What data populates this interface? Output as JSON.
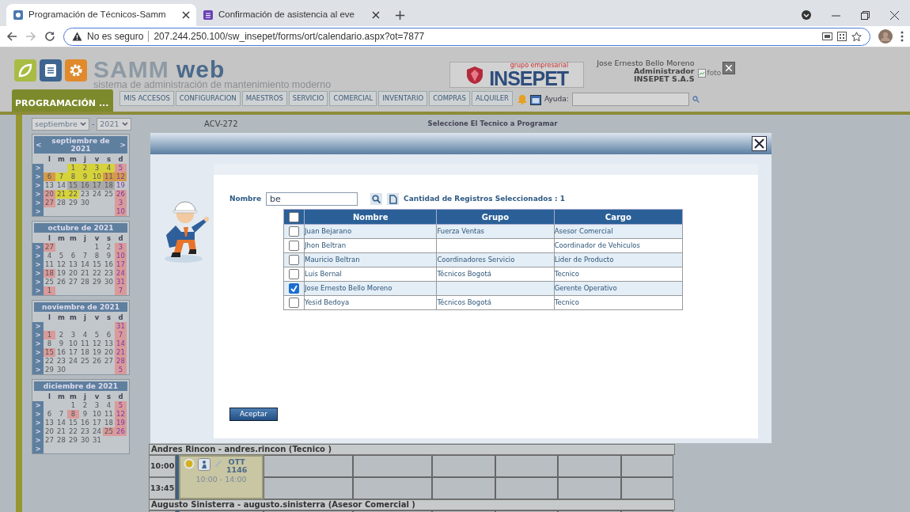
{
  "browser": {
    "tabs": [
      {
        "title": "Programación de Técnicos-Samm",
        "selected": true
      },
      {
        "title": "Confirmación de asistencia al eve",
        "selected": false
      }
    ],
    "new_tab": "+",
    "security": "No es seguro",
    "url": "207.244.250.100/sw_insepet/forms/ort/calendario.aspx?ot=7877"
  },
  "header": {
    "app_name": "SAMM",
    "app_name_suffix": "web",
    "subtitle": "sistema de administración de mantenimiento moderno",
    "partner_tag": "grupo empresarial",
    "partner_name": "INSEPET",
    "user": {
      "name": "Jose Ernesto Bello Moreno",
      "role": "Administrador",
      "company": "INSEPET S.A.S",
      "photo_alt": "foto"
    }
  },
  "nav": {
    "section": "PROGRAMACIÓN ...",
    "items": [
      "MIS ACCESOS",
      "CONFIGURACION",
      "MAESTROS",
      "SERVICIO",
      "COMERCIAL",
      "INVENTARIO",
      "COMPRAS",
      "ALQUILER"
    ],
    "help_label": "Ayuda:"
  },
  "month_picker": {
    "month": "septiembre",
    "separator": "-",
    "year": "2021"
  },
  "calendars": [
    {
      "title": "septiembre de 2021",
      "prev": "<",
      "next": ">",
      "weekdays": [
        "l",
        "m",
        "m",
        "j",
        "v",
        "s",
        "d"
      ],
      "weeks": [
        {
          "marker": ">",
          "mi": {
            "text": "1",
            "color": "#d6d23a"
          },
          "j": {
            "text": "2",
            "color": "#d6d23a"
          },
          "v": {
            "text": "3",
            "color": "#d6d23a"
          },
          "s": {
            "text": "4",
            "color": "#d6d23a"
          },
          "d": {
            "text": "5",
            "color": "#d99a9a"
          }
        },
        {
          "marker": ">",
          "l": {
            "text": "6",
            "color": "#d49a4c"
          },
          "ma": {
            "text": "7",
            "color": "#d6d23a"
          },
          "mi": {
            "text": "8",
            "color": "#d6d23a"
          },
          "j": {
            "text": "9",
            "color": "#d6d23a"
          },
          "v": {
            "text": "10",
            "color": "#d6d23a"
          },
          "s": {
            "text": "11",
            "color": "#d49a4c"
          },
          "d": {
            "text": "12",
            "color": "#d49a4c"
          }
        },
        {
          "marker": ">",
          "l": "13",
          "ma": "14",
          "mi": {
            "text": "15",
            "color": "#a9a9a9"
          },
          "j": {
            "text": "16",
            "color": "#a9a9a9"
          },
          "v": {
            "text": "17",
            "color": "#a9a9a9"
          },
          "s": {
            "text": "18",
            "color": "#a9a9a9"
          },
          "d": "19"
        },
        {
          "marker": ">",
          "l": {
            "text": "20",
            "color": "#d99a9a"
          },
          "ma": {
            "text": "21",
            "color": "#d6d23a"
          },
          "mi": {
            "text": "22",
            "color": "#d6d23a"
          },
          "j": "23",
          "v": "24",
          "s": "25",
          "d": {
            "text": "26",
            "color": "#d99a9a"
          }
        },
        {
          "marker": ">",
          "l": {
            "text": "27",
            "color": "#d99a9a"
          },
          "ma": "28",
          "mi": "29",
          "j": "30",
          "d": {
            "text": "3",
            "color": "#d99a9a"
          }
        },
        {
          "marker": ">",
          "d": {
            "text": "10",
            "color": "#d99a9a"
          }
        }
      ]
    },
    {
      "title": "octubre de 2021",
      "weekdays": [
        "l",
        "m",
        "m",
        "j",
        "v",
        "s",
        "d"
      ],
      "weeks": [
        {
          "marker": ">",
          "l": {
            "text": "27",
            "color": "#d99a9a"
          },
          "v": "1",
          "s": "2",
          "d": {
            "text": "3",
            "color": "#d99a9a"
          }
        },
        {
          "marker": ">",
          "l": "4",
          "ma": "5",
          "mi": "6",
          "j": "7",
          "v": "8",
          "s": "9",
          "d": {
            "text": "10",
            "color": "#d99a9a"
          }
        },
        {
          "marker": ">",
          "l": "11",
          "ma": "12",
          "mi": "13",
          "j": "14",
          "v": "15",
          "s": "16",
          "d": {
            "text": "17",
            "color": "#d99a9a"
          }
        },
        {
          "marker": ">",
          "l": {
            "text": "18",
            "color": "#d99a9a"
          },
          "ma": "19",
          "mi": "20",
          "j": "21",
          "v": "22",
          "s": "23",
          "d": {
            "text": "24",
            "color": "#d99a9a"
          }
        },
        {
          "marker": ">",
          "l": "25",
          "ma": "26",
          "mi": "27",
          "j": "28",
          "v": "29",
          "s": "30",
          "d": {
            "text": "31",
            "color": "#d99a9a"
          }
        },
        {
          "marker": ">",
          "l": {
            "text": "1",
            "color": "#d99a9a"
          },
          "d": {
            "text": "7",
            "color": "#d99a9a"
          }
        }
      ]
    },
    {
      "title": "noviembre de 2021",
      "weekdays": [
        "l",
        "m",
        "m",
        "j",
        "v",
        "s",
        "d"
      ],
      "weeks": [
        {
          "marker": ">",
          "d": {
            "text": "31",
            "color": "#d99a9a"
          }
        },
        {
          "marker": ">",
          "l": {
            "text": "1",
            "color": "#d99a9a"
          },
          "ma": "2",
          "mi": "3",
          "j": "4",
          "v": "5",
          "s": "6",
          "d": {
            "text": "7",
            "color": "#d99a9a"
          }
        },
        {
          "marker": ">",
          "l": "8",
          "ma": "9",
          "mi": "10",
          "j": "11",
          "v": "12",
          "s": "13",
          "d": {
            "text": "14",
            "color": "#d99a9a"
          }
        },
        {
          "marker": ">",
          "l": {
            "text": "15",
            "color": "#d99a9a"
          },
          "ma": "16",
          "mi": "17",
          "j": "18",
          "v": "19",
          "s": "20",
          "d": {
            "text": "21",
            "color": "#d99a9a"
          }
        },
        {
          "marker": ">",
          "l": "22",
          "ma": "23",
          "mi": "24",
          "j": "25",
          "v": "26",
          "s": "27",
          "d": {
            "text": "28",
            "color": "#d99a9a"
          }
        },
        {
          "marker": ">",
          "l": "29",
          "ma": "30",
          "d": {
            "text": "5",
            "color": "#d99a9a"
          }
        }
      ]
    },
    {
      "title": "diciembre de 2021",
      "weekdays": [
        "l",
        "m",
        "m",
        "j",
        "v",
        "s",
        "d"
      ],
      "weeks": [
        {
          "marker": ">",
          "mi": "1",
          "j": "2",
          "v": "3",
          "s": "4",
          "d": {
            "text": "5",
            "color": "#d99a9a"
          }
        },
        {
          "marker": ">",
          "l": "6",
          "ma": "7",
          "mi": {
            "text": "8",
            "color": "#d99a9a"
          },
          "j": "9",
          "v": "10",
          "s": "11",
          "d": {
            "text": "12",
            "color": "#d99a9a"
          }
        },
        {
          "marker": ">",
          "l": "13",
          "ma": "14",
          "mi": "15",
          "j": "16",
          "v": "17",
          "s": "18",
          "d": {
            "text": "19",
            "color": "#d99a9a"
          }
        },
        {
          "marker": ">",
          "l": "20",
          "ma": "21",
          "mi": "22",
          "j": "23",
          "v": "24",
          "s": {
            "text": "25",
            "color": "#d99a9a"
          },
          "d": {
            "text": "26",
            "color": "#d99a9a"
          }
        },
        {
          "marker": ">",
          "l": "27",
          "ma": "28",
          "mi": "29",
          "j": "30",
          "v": "31"
        },
        {
          "marker": ">"
        }
      ]
    }
  ],
  "ot_code": "ACV-272",
  "prompt": "Seleccione El Tecnico a Programar",
  "schedule": [
    {
      "title": "Andres Rincon - andres.rincon (Tecnico )",
      "times": [
        "10:00",
        "13:45"
      ],
      "event": {
        "code": "OTT",
        "number": "1146",
        "range": "10:00 - 14:00"
      }
    },
    {
      "title": "Augusto Sinisterra - augusto.sinisterra (Asesor Comercial )"
    }
  ],
  "dialog": {
    "search_label": "Nombre",
    "search_value": "be",
    "selected_count": "Cantidad de Registros Seleccionados : 1",
    "select_all": false,
    "columns": [
      "Nombre",
      "Grupo",
      "Cargo"
    ],
    "rows": [
      {
        "nombre": "Juan Bejarano",
        "grupo": "Fuerza Ventas",
        "cargo": "Asesor Comercial",
        "checked": false
      },
      {
        "nombre": "Jhon Beltran",
        "cargo": "Coordinador de Vehiculos",
        "checked": false
      },
      {
        "nombre": "Mauricio Beltran",
        "grupo": "Coordinadores Servicio",
        "cargo": "Lider de Producto",
        "checked": false
      },
      {
        "nombre": "Luis Bernal",
        "grupo": "Técnicos Bogotá",
        "cargo": "Tecnico",
        "checked": false
      },
      {
        "nombre": "Jose Ernesto Bello Moreno",
        "cargo": "Gerente Operativo",
        "checked": true
      },
      {
        "nombre": "Yesid Bedoya",
        "grupo": "Técnicos Bogotá",
        "cargo": "Tecnico",
        "checked": false
      }
    ],
    "accept": "Aceptar"
  }
}
